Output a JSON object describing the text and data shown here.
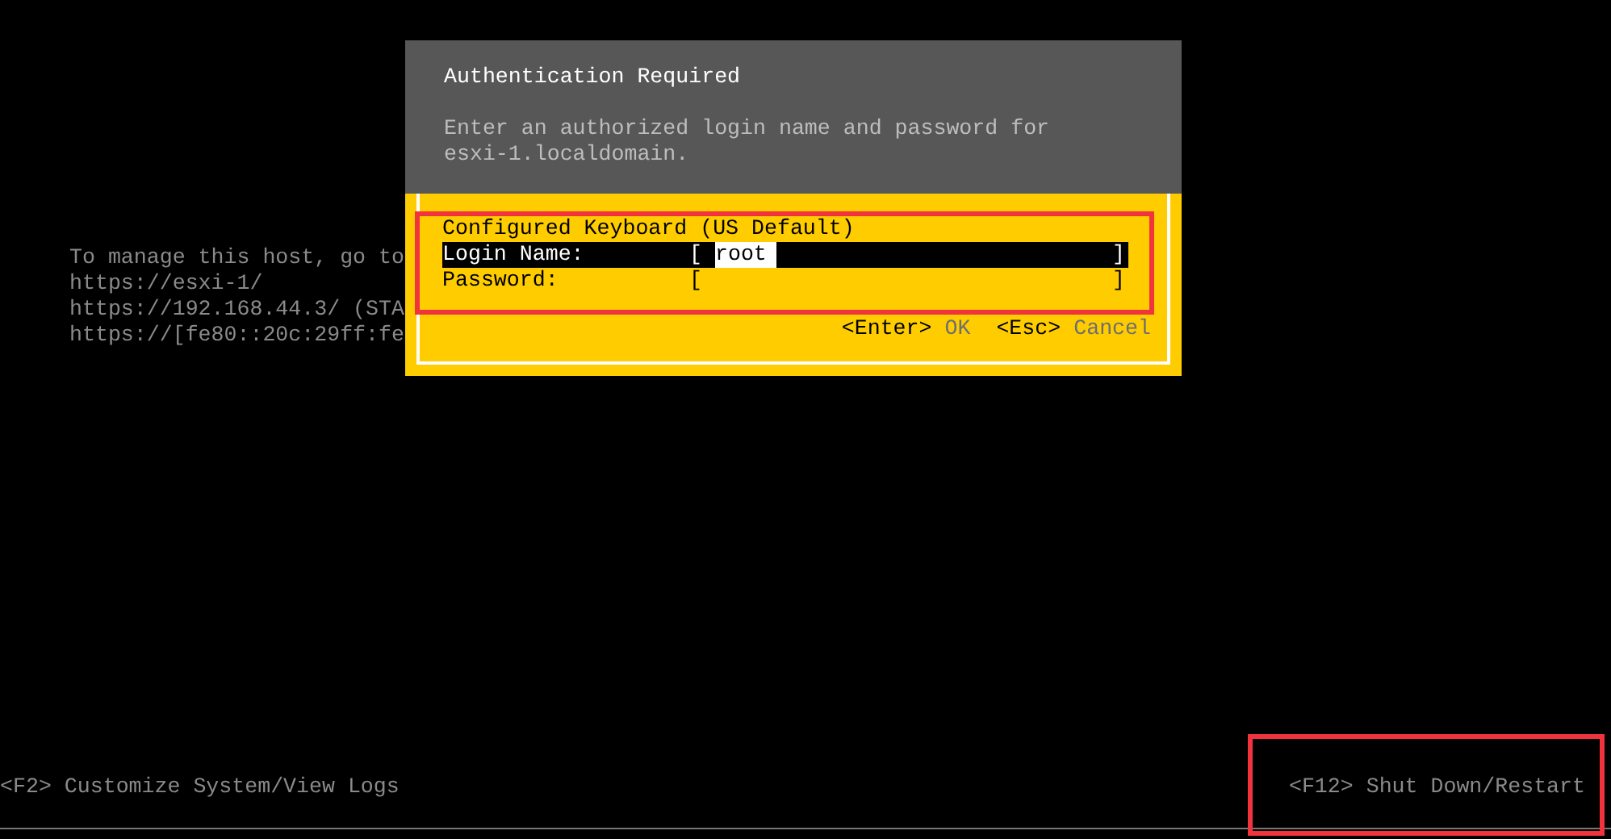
{
  "background_text": [
    "To manage this host, go to",
    "https://esxi-1/",
    "https://192.168.44.3/ (STA",
    "https://[fe80::20c:29ff:fe"
  ],
  "dialog": {
    "title": "Authentication Required",
    "message": "Enter an authorized login name and password for esxi-1.localdomain.",
    "keyboard": "Configured Keyboard (US Default)",
    "fields": [
      {
        "label": "Login Name:",
        "open": "[",
        "value": "root",
        "close": "]",
        "selected": true
      },
      {
        "label": "Password:",
        "open": "[",
        "close": "]",
        "selected": false
      }
    ],
    "actions": [
      {
        "key": "<Enter>",
        "label": "OK"
      },
      {
        "key": "<Esc>",
        "label": "Cancel"
      }
    ]
  },
  "footer": {
    "left": "<F2> Customize System/View Logs",
    "right": "<F12> Shut Down/Restart"
  }
}
